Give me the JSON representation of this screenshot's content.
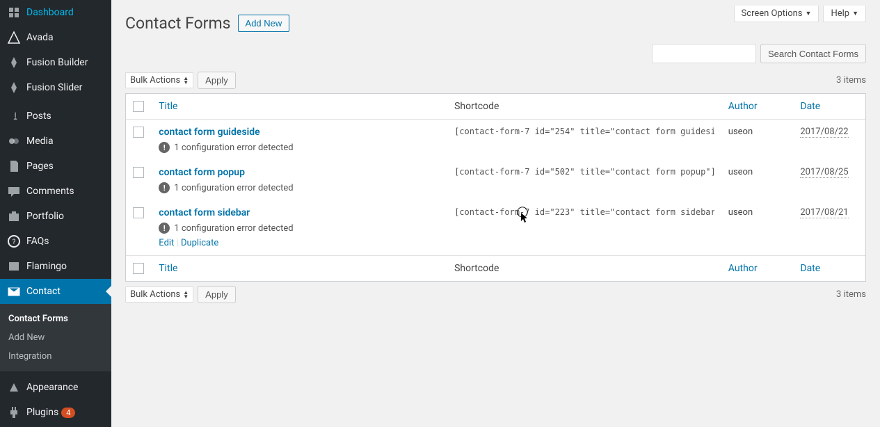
{
  "top": {
    "screen_options": "Screen Options",
    "help": "Help"
  },
  "sidebar": {
    "items": [
      {
        "label": "Dashboard",
        "icon": "dashboard"
      },
      {
        "label": "Avada",
        "icon": "avada"
      },
      {
        "label": "Fusion Builder",
        "icon": "fusion"
      },
      {
        "label": "Fusion Slider",
        "icon": "fusion"
      },
      {
        "label": "Posts",
        "icon": "pin"
      },
      {
        "label": "Media",
        "icon": "media"
      },
      {
        "label": "Pages",
        "icon": "page"
      },
      {
        "label": "Comments",
        "icon": "comment"
      },
      {
        "label": "Portfolio",
        "icon": "portfolio"
      },
      {
        "label": "FAQs",
        "icon": "faq"
      },
      {
        "label": "Flamingo",
        "icon": "flamingo"
      },
      {
        "label": "Contact",
        "icon": "mail"
      },
      {
        "label": "Appearance",
        "icon": "appearance"
      },
      {
        "label": "Plugins",
        "icon": "plugin",
        "badge": "4"
      }
    ],
    "submenu": [
      {
        "label": "Contact Forms",
        "active": true
      },
      {
        "label": "Add New"
      },
      {
        "label": "Integration"
      }
    ]
  },
  "header": {
    "title": "Contact Forms",
    "add_new": "Add New"
  },
  "search": {
    "button": "Search Contact Forms"
  },
  "bulk": {
    "label": "Bulk Actions",
    "apply": "Apply"
  },
  "count": "3 items",
  "columns": {
    "title": "Title",
    "shortcode": "Shortcode",
    "author": "Author",
    "date": "Date"
  },
  "error_text": "1 configuration error detected",
  "row_actions": {
    "edit": "Edit",
    "duplicate": "Duplicate"
  },
  "rows": [
    {
      "title": "contact form guideside",
      "shortcode": "[contact-form-7 id=\"254\" title=\"contact form guidesi",
      "author": "useon",
      "date": "2017/08/22",
      "show_actions": false
    },
    {
      "title": "contact form popup",
      "shortcode": "[contact-form-7 id=\"502\" title=\"contact form popup\"]",
      "author": "useon",
      "date": "2017/08/25",
      "show_actions": false
    },
    {
      "title": "contact form sidebar",
      "shortcode": "[contact-form-7 id=\"223\" title=\"contact form sidebar",
      "author": "useon",
      "date": "2017/08/21",
      "show_actions": true
    }
  ]
}
